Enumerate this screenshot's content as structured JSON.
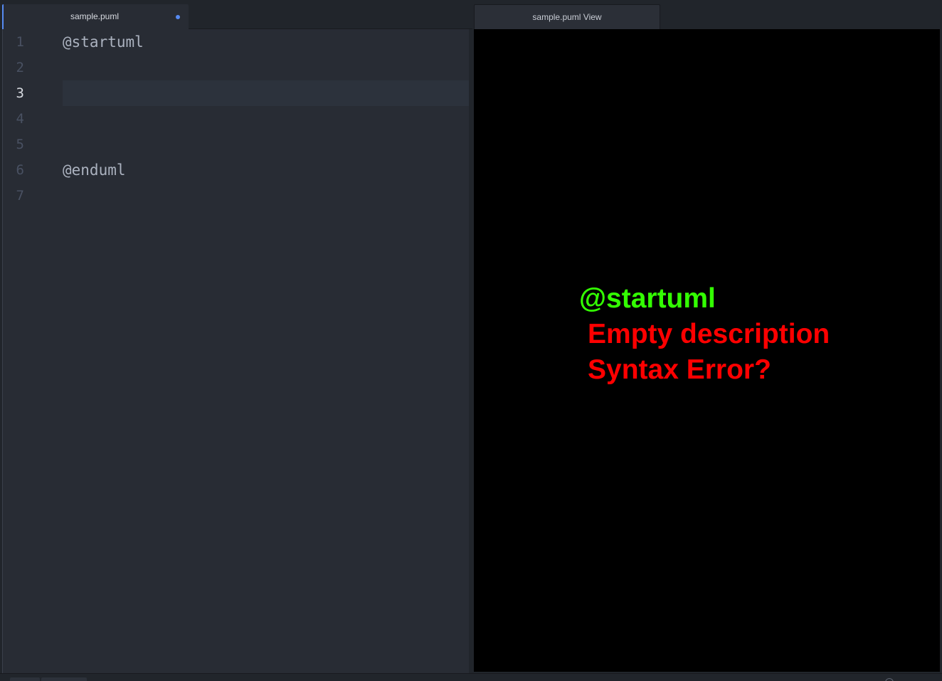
{
  "editor": {
    "tab_title": "sample.puml",
    "modified": true,
    "cursor_line": 3,
    "lines": [
      {
        "number": "1",
        "text": "@startuml"
      },
      {
        "number": "2",
        "text": ""
      },
      {
        "number": "3",
        "text": ""
      },
      {
        "number": "4",
        "text": ""
      },
      {
        "number": "5",
        "text": ""
      },
      {
        "number": "6",
        "text": "@enduml"
      },
      {
        "number": "7",
        "text": ""
      }
    ]
  },
  "viewer": {
    "tab_title": "sample.puml View",
    "preview_lines": [
      {
        "text": "@startuml",
        "color": "#33ff02"
      },
      {
        "text": "Empty description",
        "color": "#ff0000"
      },
      {
        "text": "Syntax Error?",
        "color": "#ff0000"
      }
    ]
  },
  "colors": {
    "accent": "#568af2",
    "editor_bg": "#282c34",
    "preview_bg": "#000000"
  }
}
